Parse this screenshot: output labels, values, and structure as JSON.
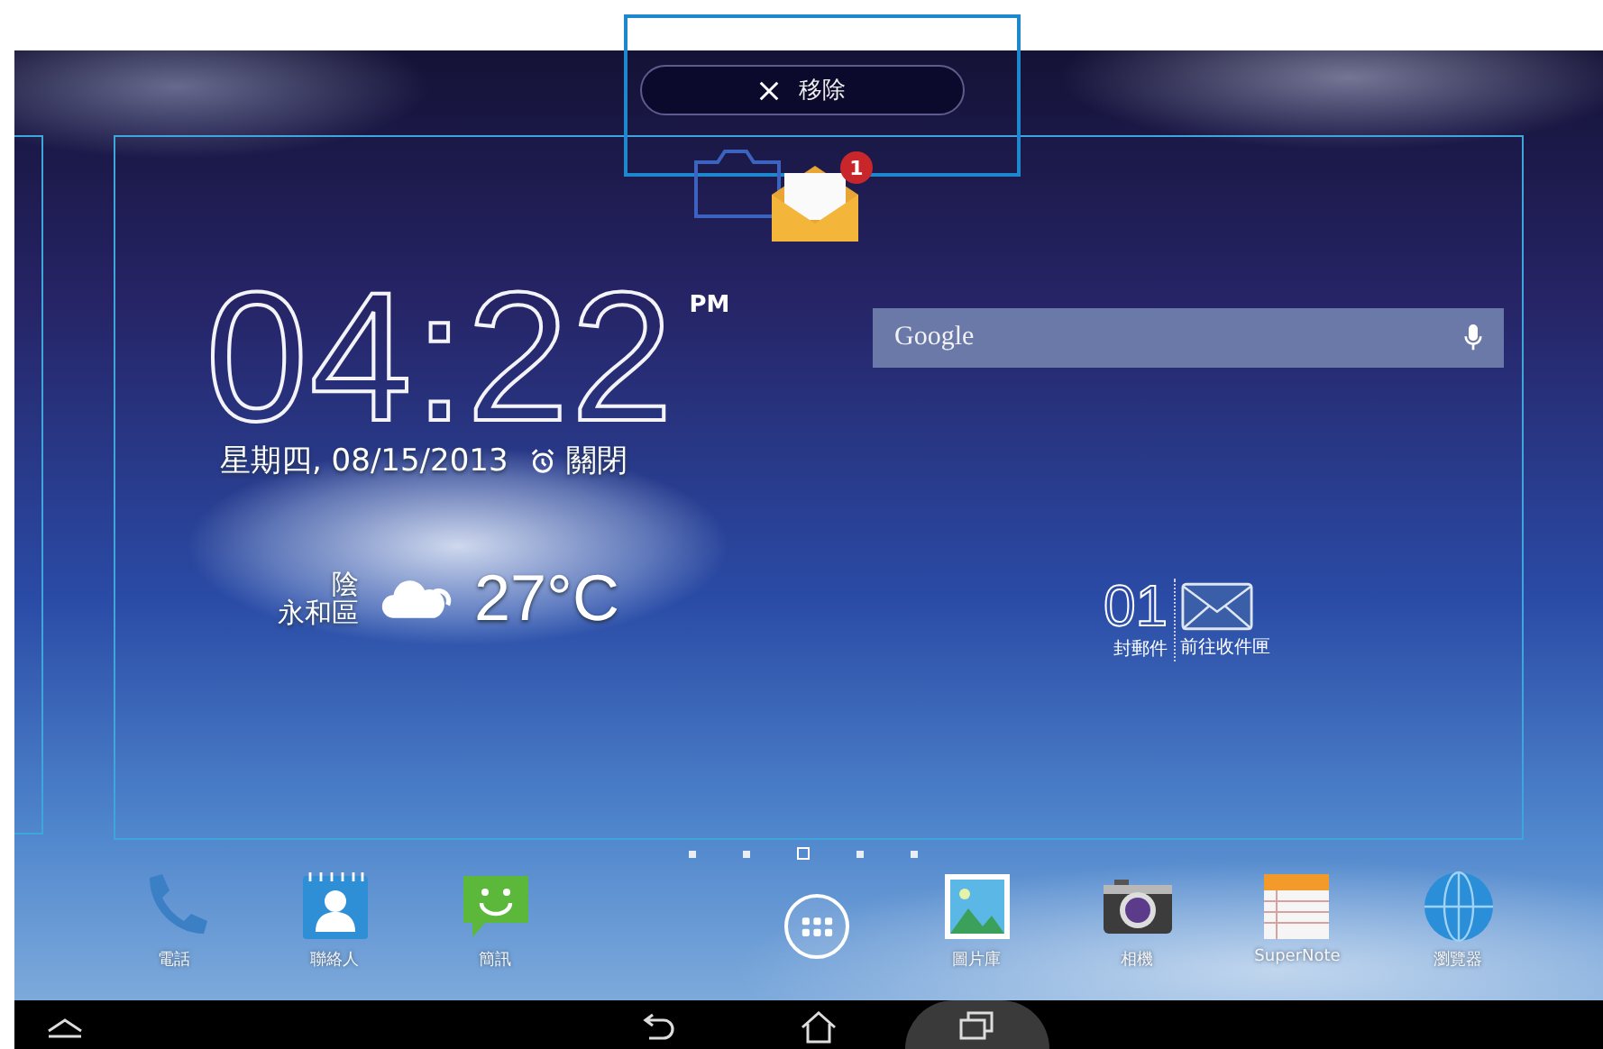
{
  "drop_zone": {
    "label": "移除"
  },
  "dragged_icon": {
    "badge": "1"
  },
  "clock": {
    "time": "04:22",
    "ampm": "PM",
    "date": "星期四, 08/15/2013",
    "alarm": "關閉"
  },
  "weather": {
    "condition": "陰",
    "location": "永和區",
    "temperature": "27°C"
  },
  "search": {
    "placeholder": "Google"
  },
  "email_widget": {
    "count": "01",
    "label": "封郵件",
    "action": "前往收件匣"
  },
  "pages": [
    {
      "selected": false
    },
    {
      "selected": false
    },
    {
      "selected": true
    },
    {
      "selected": false
    },
    {
      "selected": false
    }
  ],
  "dock": [
    {
      "kind": "phone",
      "label": "電話"
    },
    {
      "kind": "contacts",
      "label": "聯絡人"
    },
    {
      "kind": "messages",
      "label": "簡訊"
    },
    {
      "kind": "apps"
    },
    {
      "kind": "gallery",
      "label": "圖片庫"
    },
    {
      "kind": "camera",
      "label": "相機"
    },
    {
      "kind": "notes",
      "label": "SuperNote"
    },
    {
      "kind": "browser",
      "label": "瀏覽器"
    }
  ]
}
